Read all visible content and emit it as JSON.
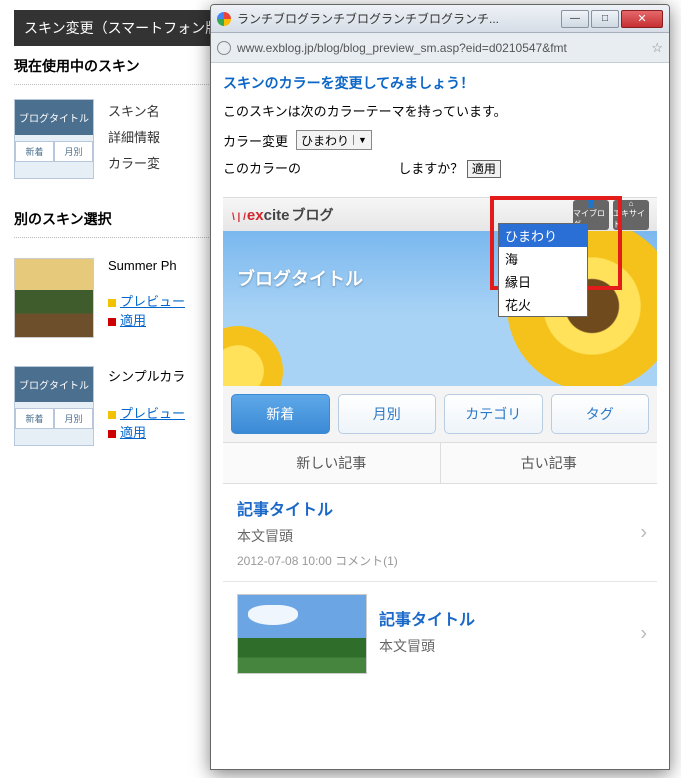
{
  "bg": {
    "section_title": "スキン変更（スマートフォン版）",
    "current_heading": "現在使用中のスキン",
    "thumb_title": "ブログタイトル",
    "thumb_tab1": "新着",
    "thumb_tab2": "月別",
    "info_name_label": "スキン名",
    "info_detail_label": "詳細情報",
    "info_color_label": "カラー変",
    "other_heading": "別のスキン選択",
    "skins": [
      {
        "name": "Summer Ph",
        "preview": "プレビュー",
        "apply": "適用"
      },
      {
        "name": "シンプルカラ",
        "preview": "プレビュー",
        "apply": "適用"
      }
    ]
  },
  "browser": {
    "tab_title": "ランチブログランチブログランチブログランチ...",
    "url": "www.exblog.jp/blog/blog_preview_sm.asp?eid=d0210547&fmt",
    "minimize": "—",
    "maximize": "□"
  },
  "page": {
    "heading": "スキンのカラーを変更してみましょう！",
    "desc": "このスキンは次のカラーテーマを持っています。",
    "color_label": "カラー変更",
    "selected": "ひまわり",
    "options": [
      "ひまわり",
      "海",
      "縁日",
      "花火"
    ],
    "confirm_prefix": "このカラーの",
    "confirm_suffix": "しますか？",
    "apply": "適用"
  },
  "mobile": {
    "logo_ex": "e",
    "logo_x": "x",
    "logo_cite": "cite",
    "logo_blog": "ブログ",
    "btn_myblog": "マイブログ",
    "btn_excite": "エキサイト",
    "blog_title": "ブログタイトル",
    "tabs": [
      "新着",
      "月別",
      "カテゴリ",
      "タグ"
    ],
    "nav_new": "新しい記事",
    "nav_old": "古い記事",
    "art1_title": "記事タイトル",
    "art1_lead": "本文冒頭",
    "art1_meta": "2012-07-08 10:00 コメント(1)",
    "art2_title": "記事タイトル",
    "art2_lead": "本文冒頭"
  }
}
